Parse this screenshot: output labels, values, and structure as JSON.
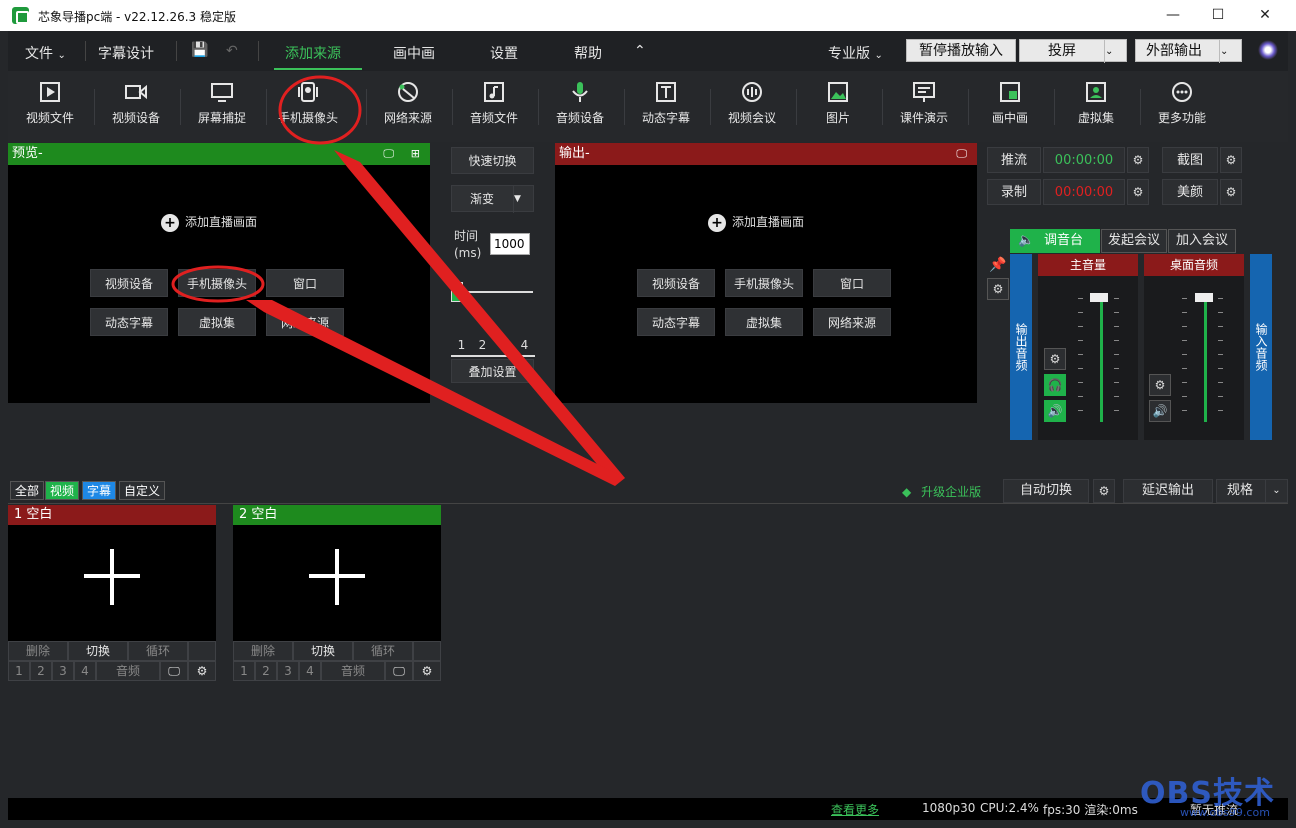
{
  "window": {
    "title": "芯象导播pc端 - v22.12.26.3 稳定版"
  },
  "menu": {
    "file": "文件",
    "subtitle_design": "字幕设计",
    "tabs": [
      "添加来源",
      "画中画",
      "设置",
      "帮助"
    ],
    "active_tab": "添加来源",
    "pro_version": "专业版",
    "pause_input": "暂停播放输入",
    "cast": "投屏",
    "external_output": "外部输出"
  },
  "toolbar": {
    "items": [
      "视频文件",
      "视频设备",
      "屏幕捕捉",
      "手机摄像头",
      "网络来源",
      "音频文件",
      "音频设备",
      "动态字幕",
      "视频会议",
      "图片",
      "课件演示",
      "画中画",
      "虚拟集",
      "更多功能"
    ]
  },
  "preview": {
    "title": "预览-",
    "add_live": "添加直播画面",
    "buttons": [
      "视频设备",
      "手机摄像头",
      "窗口",
      "动态字幕",
      "虚拟集",
      "网络来源"
    ]
  },
  "output": {
    "title": "输出-",
    "add_live": "添加直播画面",
    "buttons": [
      "视频设备",
      "手机摄像头",
      "窗口",
      "动态字幕",
      "虚拟集",
      "网络来源"
    ]
  },
  "middle": {
    "quick_switch": "快速切换",
    "transition": "渐变",
    "time_label": "时间",
    "time_unit": "(ms)",
    "time_value": "1000",
    "numbers": [
      "1",
      "2",
      "3",
      "4"
    ],
    "overlay_settings": "叠加设置"
  },
  "right": {
    "stream": "推流",
    "stream_time": "00:00:00",
    "record": "录制",
    "record_time": "00:00:00",
    "screenshot": "截图",
    "beauty": "美颜",
    "mixer": "调音台",
    "start_meeting": "发起会议",
    "join_meeting": "加入会议",
    "output_audio": "输出音频",
    "input_audio": "输入音频",
    "master_volume": "主音量",
    "desktop_audio": "桌面音频"
  },
  "tabs_bar": {
    "tabs": [
      "全部",
      "视频",
      "字幕",
      "自定义"
    ],
    "upgrade": "升级企业版",
    "auto_switch": "自动切换",
    "delay_output": "延迟输出",
    "spec": "规格"
  },
  "scenes": [
    {
      "title": "1 空白",
      "actions": [
        "删除",
        "切换",
        "循环"
      ],
      "nums": [
        "1",
        "2",
        "3",
        "4"
      ],
      "audio": "音频"
    },
    {
      "title": "2 空白",
      "actions": [
        "删除",
        "切换",
        "循环"
      ],
      "nums": [
        "1",
        "2",
        "3",
        "4"
      ],
      "audio": "音频"
    }
  ],
  "status": {
    "more": "查看更多",
    "resolution": "1080p30",
    "cpu": "CPU:2.4%",
    "fps": "fps:30 渲染:0ms",
    "stream_state": "暂无推流"
  },
  "watermark": {
    "text": "OBS技术",
    "url": "www.obs99.com"
  },
  "colors": {
    "accent_green": "#3bc15a",
    "preview_head": "#1e8a1e",
    "output_head": "#8b1a1a",
    "annotation_red": "#e02020",
    "blue_strip": "#1565b0"
  }
}
